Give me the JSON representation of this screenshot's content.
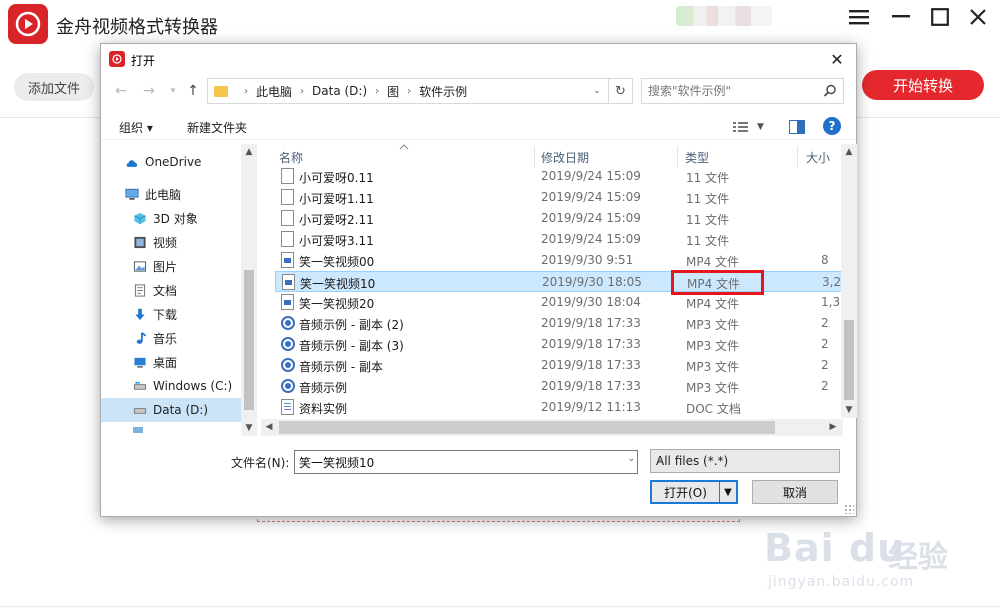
{
  "app": {
    "title": "金舟视频格式转换器",
    "add_file_label": "添加文件",
    "start_label": "开始转换",
    "accent_color": "#e5282d"
  },
  "dialog": {
    "title": "打开",
    "address": [
      "此电脑",
      "Data (D:)",
      "图",
      "软件示例"
    ],
    "search_placeholder": "搜索\"软件示例\"",
    "toolbar": {
      "organize_label": "组织 ▾",
      "new_folder_label": "新建文件夹"
    },
    "nav": [
      {
        "label": "OneDrive",
        "icon": "cloud-icon"
      },
      {
        "label": "此电脑",
        "icon": "computer-icon"
      },
      {
        "label": "3D 对象",
        "icon": "cube-icon"
      },
      {
        "label": "视频",
        "icon": "video-icon"
      },
      {
        "label": "图片",
        "icon": "picture-icon"
      },
      {
        "label": "文档",
        "icon": "document-icon"
      },
      {
        "label": "下载",
        "icon": "download-icon"
      },
      {
        "label": "音乐",
        "icon": "music-icon"
      },
      {
        "label": "桌面",
        "icon": "desktop-icon"
      },
      {
        "label": "Windows (C:)",
        "icon": "drive-icon"
      },
      {
        "label": "Data (D:)",
        "icon": "drive-icon",
        "selected": true
      }
    ],
    "columns": {
      "name": "名称",
      "date": "修改日期",
      "type": "类型",
      "size": "大小"
    },
    "files": [
      {
        "name": "小可爱呀0.11",
        "date": "2019/9/24 15:09",
        "type": "11 文件",
        "size": "",
        "kind": "blank"
      },
      {
        "name": "小可爱呀1.11",
        "date": "2019/9/24 15:09",
        "type": "11 文件",
        "size": "",
        "kind": "blank"
      },
      {
        "name": "小可爱呀2.11",
        "date": "2019/9/24 15:09",
        "type": "11 文件",
        "size": "",
        "kind": "blank"
      },
      {
        "name": "小可爱呀3.11",
        "date": "2019/9/24 15:09",
        "type": "11 文件",
        "size": "",
        "kind": "blank"
      },
      {
        "name": "笑一笑视频00",
        "date": "2019/9/30 9:51",
        "type": "MP4 文件",
        "size": "8",
        "kind": "mp4"
      },
      {
        "name": "笑一笑视频10",
        "date": "2019/9/30 18:05",
        "type": "MP4 文件",
        "size": "3,2",
        "kind": "mp4",
        "selected": true
      },
      {
        "name": "笑一笑视频20",
        "date": "2019/9/30 18:04",
        "type": "MP4 文件",
        "size": "1,3",
        "kind": "mp4"
      },
      {
        "name": "音频示例 - 副本 (2)",
        "date": "2019/9/18 17:33",
        "type": "MP3 文件",
        "size": "2",
        "kind": "mp3"
      },
      {
        "name": "音频示例 - 副本 (3)",
        "date": "2019/9/18 17:33",
        "type": "MP3 文件",
        "size": "2",
        "kind": "mp3"
      },
      {
        "name": "音频示例 - 副本",
        "date": "2019/9/18 17:33",
        "type": "MP3 文件",
        "size": "2",
        "kind": "mp3"
      },
      {
        "name": "音频示例",
        "date": "2019/9/18 17:33",
        "type": "MP3 文件",
        "size": "2",
        "kind": "mp3"
      },
      {
        "name": "资料实例",
        "date": "2019/9/12 11:13",
        "type": "DOC 文档",
        "size": "",
        "kind": "doc"
      }
    ],
    "filename_label": "文件名(N):",
    "filename_value": "笑一笑视频10",
    "filter_value": "All files (*.*)",
    "open_label": "打开(O)",
    "cancel_label": "取消"
  },
  "watermark": {
    "brand": "Bai du",
    "jingyan": "经验",
    "url": "jingyan.baidu.com"
  }
}
